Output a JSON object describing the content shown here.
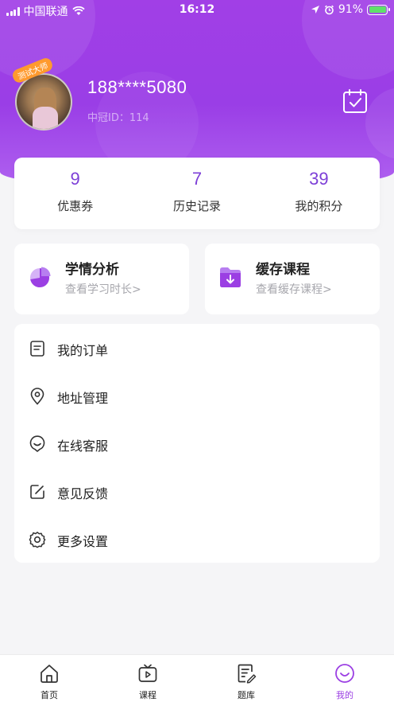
{
  "status_bar": {
    "carrier": "中国联通",
    "time": "16:12",
    "battery": "91%"
  },
  "profile": {
    "badge": "测试大师",
    "phone": "188****5080",
    "uid": "中冠ID：114"
  },
  "stats": [
    {
      "value": "9",
      "label": "优惠券"
    },
    {
      "value": "7",
      "label": "历史记录"
    },
    {
      "value": "39",
      "label": "我的积分"
    }
  ],
  "cards": [
    {
      "title": "学情分析",
      "subtitle": "查看学习时长>",
      "icon": "pie-chart-icon"
    },
    {
      "title": "缓存课程",
      "subtitle": "查看缓存课程>",
      "icon": "download-folder-icon"
    }
  ],
  "menu": [
    {
      "label": "我的订单",
      "icon": "order-icon"
    },
    {
      "label": "地址管理",
      "icon": "location-pin-icon"
    },
    {
      "label": "在线客服",
      "icon": "customer-service-icon"
    },
    {
      "label": "意见反馈",
      "icon": "edit-feedback-icon"
    },
    {
      "label": "更多设置",
      "icon": "gear-icon"
    }
  ],
  "tabs": [
    {
      "label": "首页",
      "icon": "home-icon"
    },
    {
      "label": "课程",
      "icon": "tv-icon"
    },
    {
      "label": "题库",
      "icon": "notebook-icon"
    },
    {
      "label": "我的",
      "icon": "smile-icon",
      "active": true
    }
  ],
  "colors": {
    "accent": "#9b3fe3",
    "stat_number": "#7d3fd7",
    "header_gradient_top": "#a13fe6"
  }
}
